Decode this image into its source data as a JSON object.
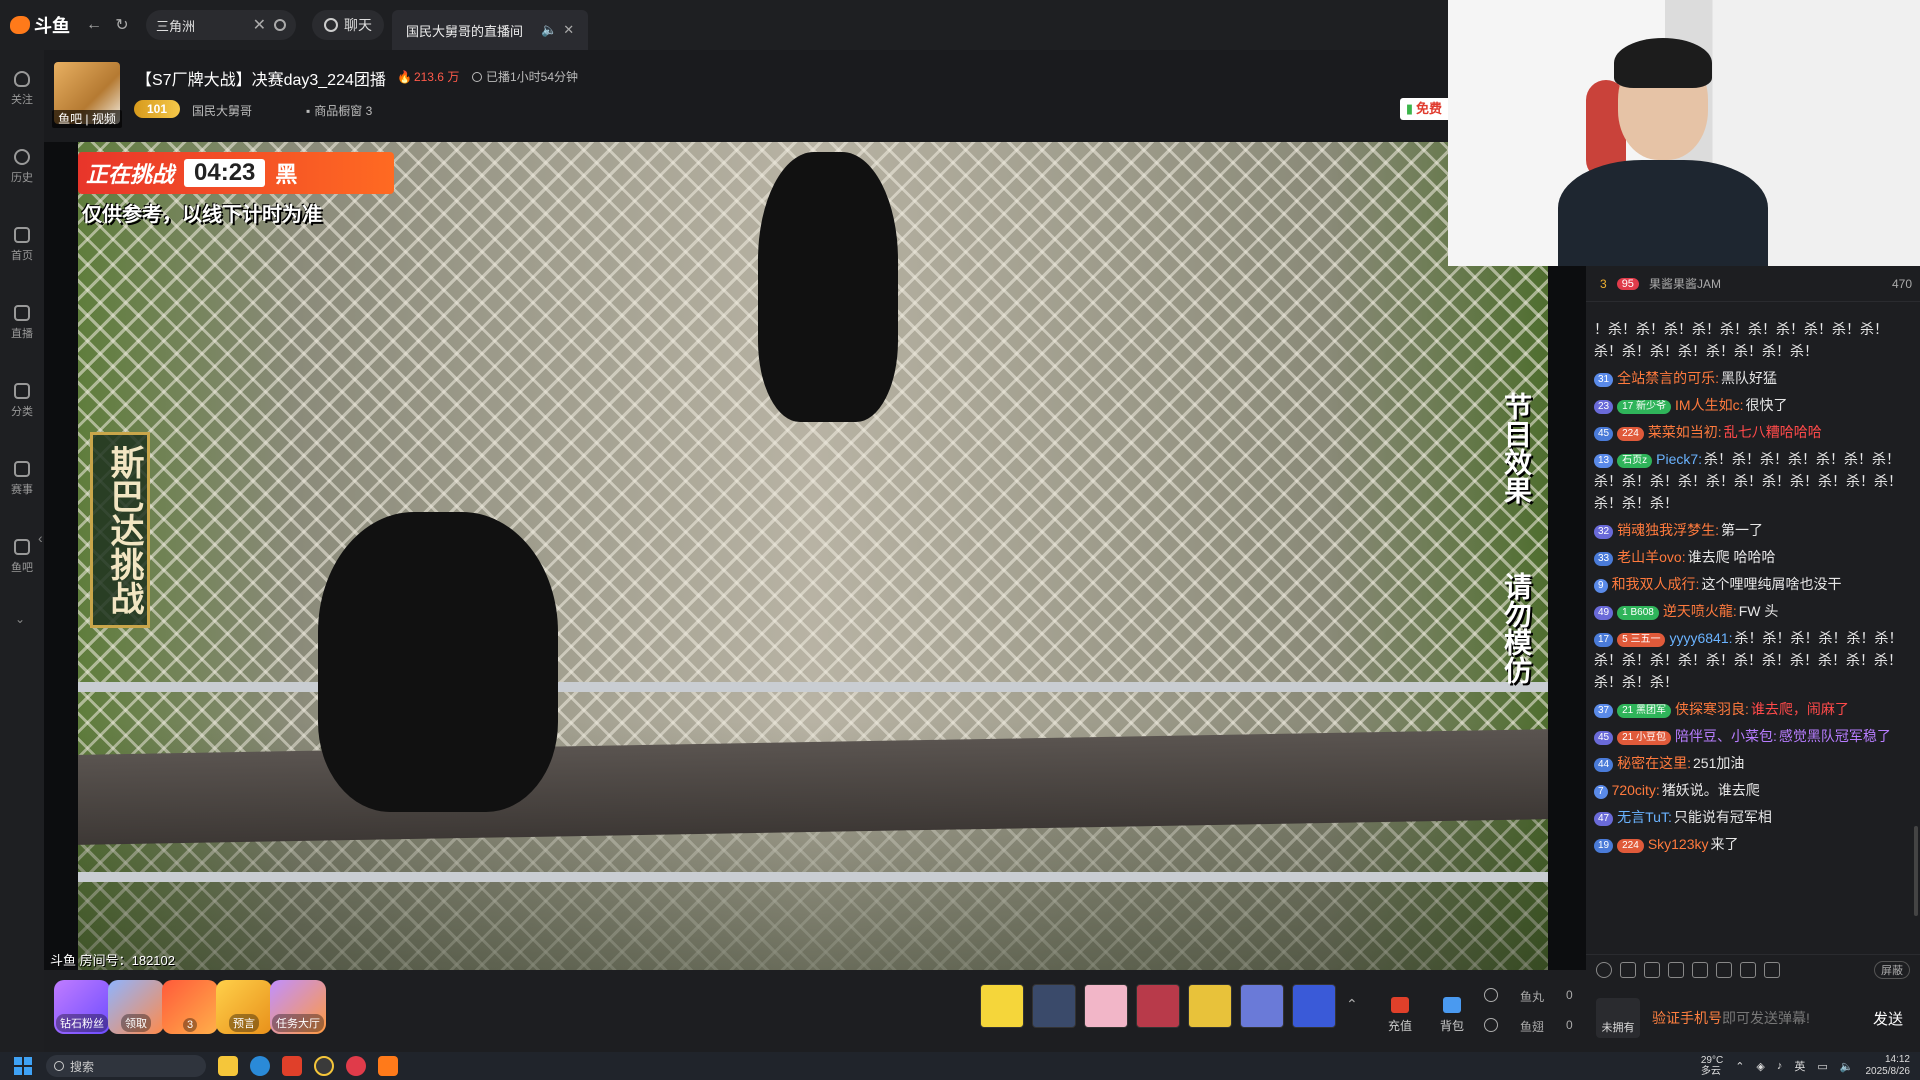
{
  "topbar": {
    "logo_text": "斗鱼",
    "search_value": "三角洲",
    "chat_label": "聊天",
    "tab_title": "国民大舅哥的直播间",
    "tab_mute_icon": "speaker-icon",
    "tab_close": "✕"
  },
  "sidebar": {
    "items": [
      {
        "label": "关注",
        "icon": "heart-icon"
      },
      {
        "label": "历史",
        "icon": "clock-icon"
      },
      {
        "label": "首页",
        "icon": "home-icon"
      },
      {
        "label": "直播",
        "icon": "tv-icon"
      },
      {
        "label": "分类",
        "icon": "grid-icon"
      },
      {
        "label": "赛事",
        "icon": "trophy-icon"
      },
      {
        "label": "鱼吧",
        "icon": "fishbar-icon"
      }
    ]
  },
  "room": {
    "avatar_label": "鱼吧 | 视频",
    "title": "【S7厂牌大战】决赛day3_224团播",
    "hot": "213.6 万",
    "live_time": "已播1小时54分钟",
    "level": "101",
    "streamer": "国民大舅哥",
    "shop": "商品橱窗 3",
    "free_badge": "免费"
  },
  "video": {
    "banner_challenge": "正在挑战",
    "banner_timer": "04:23",
    "banner_team": "黑",
    "banner_note": "仅供参考，以线下计时为准",
    "left_caption": "斯巴达挑战",
    "right_caption_1": "节目效果",
    "right_caption_2": "请勿模仿",
    "room_id": "斗鱼 房间号：182102"
  },
  "chat": {
    "rank": {
      "num": "3",
      "badge": "95",
      "name": "果酱果酱JAM",
      "value": "470"
    },
    "messages": [
      {
        "lv": "",
        "fan": "",
        "user": "",
        "text": "！杀！杀！杀！杀！杀！杀！杀！杀！杀！杀！杀！杀！杀！杀！杀！杀！杀！杀！"
      },
      {
        "lv": "31",
        "fan": "",
        "user": "全站禁言的可乐:",
        "text": "黑队好猛"
      },
      {
        "lv": "23",
        "fan": "17 新少爷",
        "user": "IM人生如c:",
        "text": "很快了"
      },
      {
        "lv": "45",
        "fan": "224",
        "user": "菜菜如当初:",
        "text": "乱七八糟哈哈哈",
        "red": true
      },
      {
        "lv": "13",
        "fan": "石页z",
        "user": "Pieck7:",
        "text": "杀！杀！杀！杀！杀！杀！杀！杀！杀！杀！杀！杀！杀！杀！杀！杀！杀！杀！杀！杀！杀！"
      },
      {
        "lv": "32",
        "fan": "",
        "user": "销魂独我浮梦生:",
        "text": "第一了"
      },
      {
        "lv": "33",
        "fan": "",
        "user": "老山羊ovo:",
        "text": "谁去爬 哈哈哈"
      },
      {
        "lv": "9",
        "fan": "",
        "user": "和我双人成行:",
        "text": "这个哩哩纯屑啥也没干"
      },
      {
        "lv": "49",
        "fan": "1 B608",
        "user": "逆天喷火龍:",
        "text": "FW 头"
      },
      {
        "lv": "17",
        "fan": "5 三五一",
        "user": "yyyy6841:",
        "text": "杀！杀！杀！杀！杀！杀！杀！杀！杀！杀！杀！杀！杀！杀！杀！杀！杀！杀！杀！杀！"
      },
      {
        "lv": "37",
        "fan": "21 黑团军",
        "user": "侠探寒羽良:",
        "text": "谁去爬，闹麻了",
        "red": true
      },
      {
        "lv": "45",
        "fan": "21 小豆包",
        "user": "陪伴豆、小菜包:",
        "text": "感觉黑队冠军稳了",
        "purple": true
      },
      {
        "lv": "44",
        "fan": "",
        "user": "秘密在这里:",
        "text": "251加油"
      },
      {
        "lv": "7",
        "fan": "",
        "user": "720city:",
        "text": "猪妖说。谁去爬"
      },
      {
        "lv": "47",
        "fan": "",
        "user": "无言TuT:",
        "text": "只能说有冠军相"
      },
      {
        "lv": "19",
        "fan": "224",
        "user": "Sky123ky",
        "text": "来了"
      }
    ],
    "shield_label": "屏蔽",
    "no_own": "未拥有",
    "verify_link": "验证手机号",
    "verify_rest": "即可发送弹幕!",
    "send": "发送"
  },
  "giftbar": {
    "acts": [
      "钻石粉丝",
      "领取",
      "",
      "预言",
      "任务大厅"
    ],
    "recharge": "充值",
    "backpack": "背包",
    "fish_ball": "鱼丸",
    "fish_ball_count": "0",
    "fish_wing": "鱼翅",
    "fish_wing_count": "0",
    "act_badge": "3"
  },
  "taskbar": {
    "search": "搜索",
    "weather_temp": "29°C",
    "weather_desc": "多云",
    "ime": "英",
    "time": "14:12",
    "date": "2025/8/26"
  }
}
